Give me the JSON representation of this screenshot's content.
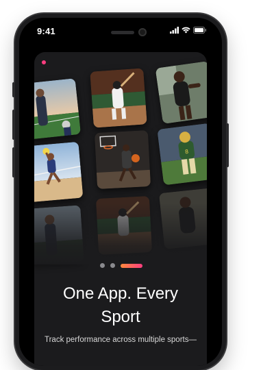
{
  "status_bar": {
    "time": "9:41"
  },
  "onboarding": {
    "headline_line1": "One App. Every",
    "headline_line2": "Sport",
    "subtext": "Track performance across multiple sports—",
    "pagination": {
      "total": 3,
      "active": 3
    }
  },
  "gallery": [
    {
      "sport": "american-football-coach"
    },
    {
      "sport": "baseball-batter"
    },
    {
      "sport": "track-sprinter"
    },
    {
      "sport": "beach-volleyball"
    },
    {
      "sport": "basketball"
    },
    {
      "sport": "american-football-player"
    },
    {
      "sport": "american-football-coach"
    },
    {
      "sport": "baseball-batter"
    },
    {
      "sport": "track-sprinter"
    }
  ],
  "colors": {
    "accent_start": "#ff8a3d",
    "accent_end": "#ff3d7f",
    "background": "#1b1b1d"
  }
}
